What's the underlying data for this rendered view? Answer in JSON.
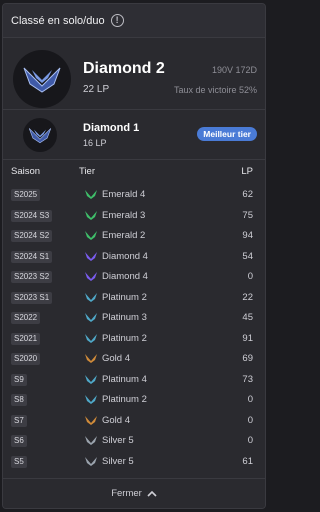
{
  "header": {
    "title": "Classé en solo/duo",
    "info_icon": "info-icon"
  },
  "current": {
    "rank": "Diamond 2",
    "lp": "22 LP",
    "record": "190V 172D",
    "winrate": "Taux de victoire 52%",
    "emblem": "diamond-emblem"
  },
  "best": {
    "rank": "Diamond 1",
    "lp": "16 LP",
    "badge": "Meilleur tier",
    "emblem": "diamond-emblem"
  },
  "table": {
    "headers": {
      "season": "Saison",
      "tier": "Tier",
      "lp": "LP"
    },
    "rows": [
      {
        "season": "S2025",
        "tier": "Emerald 4",
        "lp": "62"
      },
      {
        "season": "S2024 S3",
        "tier": "Emerald 3",
        "lp": "75"
      },
      {
        "season": "S2024 S2",
        "tier": "Emerald 2",
        "lp": "94"
      },
      {
        "season": "S2024 S1",
        "tier": "Diamond 4",
        "lp": "54"
      },
      {
        "season": "S2023 S2",
        "tier": "Diamond 4",
        "lp": "0"
      },
      {
        "season": "S2023 S1",
        "tier": "Platinum 2",
        "lp": "22"
      },
      {
        "season": "S2022",
        "tier": "Platinum 3",
        "lp": "45"
      },
      {
        "season": "S2021",
        "tier": "Platinum 2",
        "lp": "91"
      },
      {
        "season": "S2020",
        "tier": "Gold 4",
        "lp": "69"
      },
      {
        "season": "S9",
        "tier": "Platinum 4",
        "lp": "73"
      },
      {
        "season": "S8",
        "tier": "Platinum 2",
        "lp": "0"
      },
      {
        "season": "S7",
        "tier": "Gold 4",
        "lp": "0"
      },
      {
        "season": "S6",
        "tier": "Silver 5",
        "lp": "0"
      },
      {
        "season": "S5",
        "tier": "Silver 5",
        "lp": "61"
      }
    ]
  },
  "tier_colors": {
    "Emerald": "#3fbf6a",
    "Diamond": "#7a5cf0",
    "Platinum": "#4fa8c8",
    "Gold": "#d08b3a",
    "Silver": "#9aa3ad"
  },
  "footer": {
    "label": "Fermer",
    "icon": "chevron-up-icon"
  }
}
